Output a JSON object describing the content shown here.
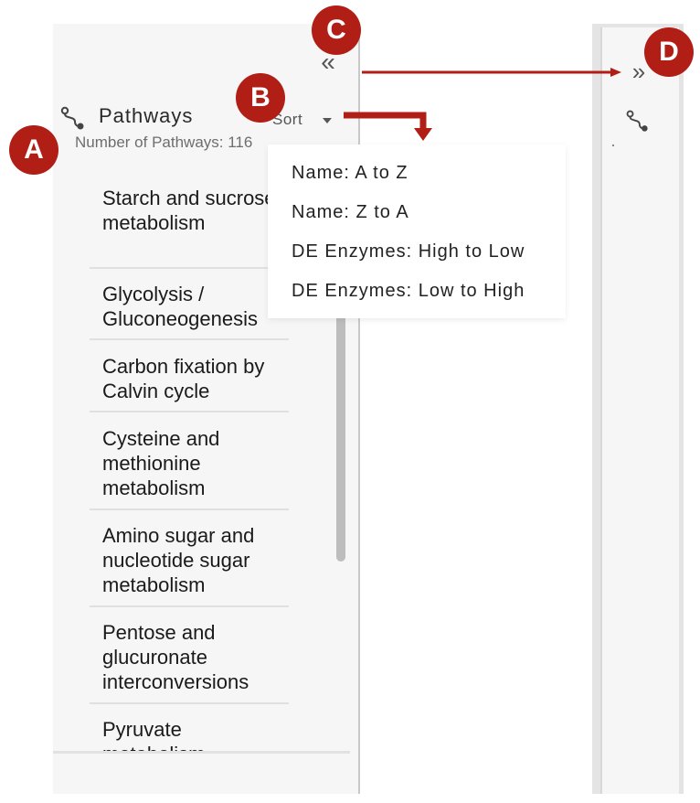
{
  "panel": {
    "title": "Pathways",
    "count_label": "Number of Pathways: 116",
    "sort_label": "Sort",
    "collapse_glyph": "«",
    "icon": "pathway-icon",
    "pathways": [
      "Starch and sucrose metabolism",
      "Glycolysis / Gluconeogenesis",
      "Carbon fixation by Calvin cycle",
      "Cysteine and methionine metabolism",
      "Amino sugar and nucleotide sugar metabolism",
      "Pentose and glucuronate interconversions",
      "Pyruvate metabolism"
    ]
  },
  "sort_menu": {
    "options": [
      "Name: A to Z",
      "Name: Z to A",
      "DE Enzymes: High to Low",
      "DE Enzymes: Low to High"
    ]
  },
  "collapsed_panel": {
    "expand_glyph": "»",
    "icon": "pathway-icon"
  },
  "annotations": {
    "markers": [
      "A",
      "B",
      "C",
      "D"
    ],
    "color": "#b01e16"
  }
}
